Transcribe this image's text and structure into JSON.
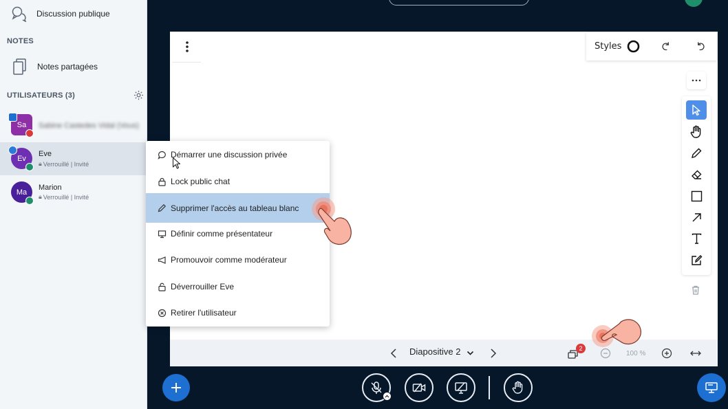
{
  "sidebar": {
    "public_chat_label": "Discussion publique",
    "notes_title": "NOTES",
    "shared_notes_label": "Notes partagées",
    "users_title": "UTILISATEURS (3)",
    "users": [
      {
        "initials": "Sa",
        "name": "Sabine Castedes Vidal (Vous)",
        "status": "",
        "color": "#8e2fa8"
      },
      {
        "initials": "Ev",
        "name": "Eve",
        "status": "Verrouillé | Invité",
        "color": "#6f2fb2"
      },
      {
        "initials": "Ma",
        "name": "Marion",
        "status": "Verrouillé | Invité",
        "color": "#4a1f9a"
      }
    ]
  },
  "menu": {
    "items": [
      {
        "label": "Démarrer une discussion privée",
        "icon": "chat-bubble-icon"
      },
      {
        "label": "Lock public chat",
        "icon": "lock-icon"
      },
      {
        "label": "Supprimer l'accès au tableau blanc",
        "icon": "pencil-icon"
      },
      {
        "label": "Définir comme présentateur",
        "icon": "presentation-icon"
      },
      {
        "label": "Promouvoir comme modérateur",
        "icon": "megaphone-icon"
      },
      {
        "label": "Déverrouiller Eve",
        "icon": "unlock-icon"
      },
      {
        "label": "Retirer l'utilisateur",
        "icon": "remove-circle-icon"
      }
    ]
  },
  "whiteboard": {
    "styles_label": "Styles",
    "slide_label": "Diapositive 2",
    "zoom_label": "100 %",
    "notification_count": "2"
  },
  "colors": {
    "accent": "#1d6fd1",
    "menu_highlight": "#b3cfec",
    "active_tool": "#4f8fe8",
    "background": "#06172a"
  }
}
